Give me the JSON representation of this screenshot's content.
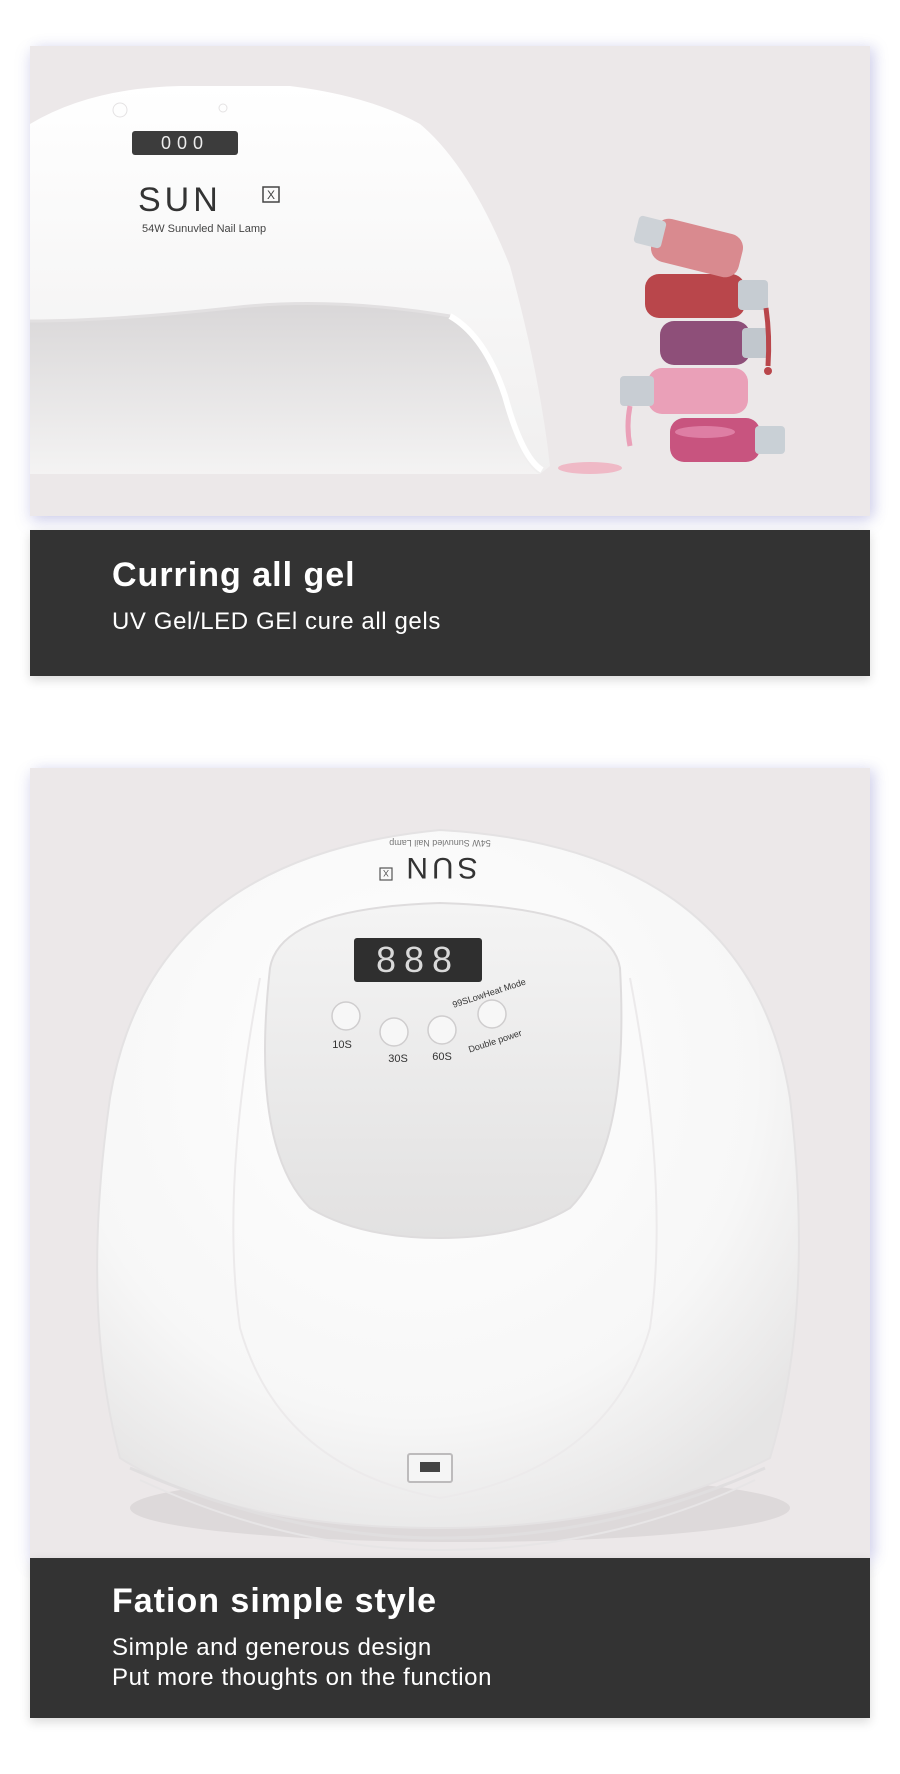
{
  "section1": {
    "product": {
      "brand": "SUN",
      "brand_mark": "X",
      "model_text": "54W Sunuvled Nail Lamp",
      "display_digits": "000"
    },
    "caption": {
      "title": "Curring all gel",
      "subtitle": "UV Gel/LED GEl cure all gels"
    },
    "bottle_colors": [
      "#d98a8f",
      "#b9464b",
      "#8e4f79",
      "#eaa0b8",
      "#c8547f"
    ]
  },
  "section2": {
    "product": {
      "brand": "SUN",
      "brand_mark": "X",
      "model_text": "54W Sunuvled Nail Lamp",
      "display_digits": "888",
      "buttons": [
        {
          "label": "10S"
        },
        {
          "label": "30S"
        },
        {
          "label": "60S"
        },
        {
          "label": "99SLowHeat Mode",
          "sublabel": "Double power"
        }
      ]
    },
    "caption": {
      "title": "Fation simple style",
      "line1": "Simple and generous design",
      "line2": "Put more thoughts on the function"
    }
  },
  "colors": {
    "band": "#333333",
    "photo_bg": "#ece8e9",
    "lamp_white": "#fbfbfb"
  }
}
